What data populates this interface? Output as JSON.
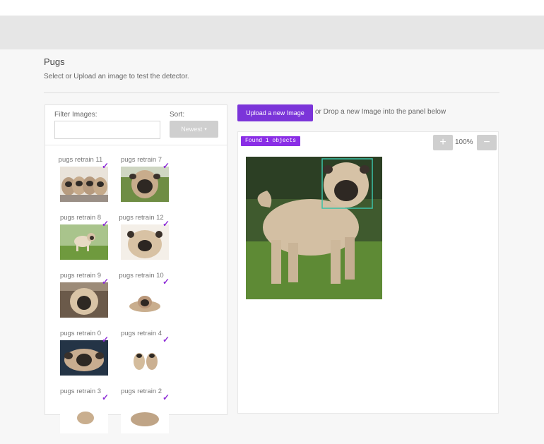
{
  "header": {
    "title": "Pugs",
    "subtitle": "Select or Upload an image to test the detector."
  },
  "sidebar": {
    "filter_label": "Filter Images:",
    "filter_value": "",
    "sort_label": "Sort:",
    "sort_value": "Newest",
    "items": [
      {
        "label": "pugs retrain 11",
        "checked": true
      },
      {
        "label": "pugs retrain 7",
        "checked": true
      },
      {
        "label": "pugs retrain 8",
        "checked": true
      },
      {
        "label": "pugs retrain 12",
        "checked": true
      },
      {
        "label": "pugs retrain 9",
        "checked": true
      },
      {
        "label": "pugs retrain 10",
        "checked": true
      },
      {
        "label": "pugs retrain 0",
        "checked": true
      },
      {
        "label": "pugs retrain 4",
        "checked": true
      },
      {
        "label": "pugs retrain 3",
        "checked": true
      },
      {
        "label": "pugs retrain 2",
        "checked": true
      }
    ]
  },
  "main": {
    "upload_label": "Upload a new Image",
    "upload_hint": "or Drop a new Image into the panel below",
    "found_label": "Found 1 objects",
    "zoom_level": "100%",
    "zoom_plus": "+",
    "zoom_minus": "−"
  },
  "colors": {
    "accent": "#7b35d9",
    "detection_box": "#3bc2a8"
  },
  "icons": {
    "check": "check-icon",
    "caret": "caret-down-icon"
  }
}
